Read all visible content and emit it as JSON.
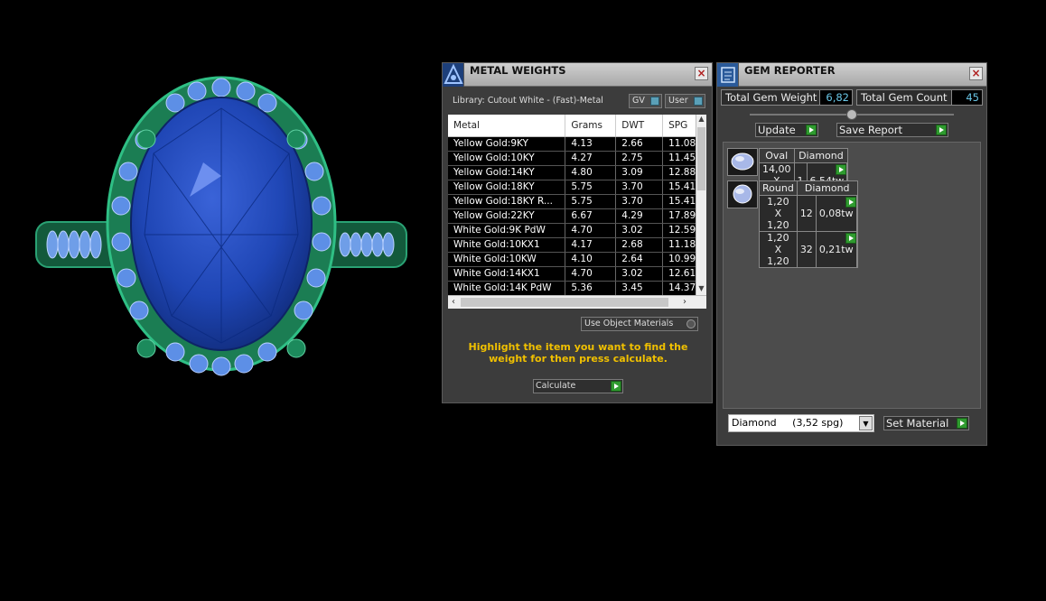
{
  "metal_weights": {
    "title": "METAL WEIGHTS",
    "library": "Library: Cutout White - (Fast)-Metal",
    "gv_label": "GV",
    "user_label": "User",
    "columns": [
      "Metal",
      "Grams",
      "DWT",
      "SPG"
    ],
    "rows": [
      [
        "Yellow Gold:9KY",
        "4.13",
        "2.66",
        "11.08"
      ],
      [
        "Yellow Gold:10KY",
        "4.27",
        "2.75",
        "11.45"
      ],
      [
        "Yellow Gold:14KY",
        "4.80",
        "3.09",
        "12.88"
      ],
      [
        "Yellow Gold:18KY",
        "5.75",
        "3.70",
        "15.41"
      ],
      [
        "Yellow Gold:18KY R...",
        "5.75",
        "3.70",
        "15.41"
      ],
      [
        "Yellow Gold:22KY",
        "6.67",
        "4.29",
        "17.89"
      ],
      [
        "White Gold:9K PdW",
        "4.70",
        "3.02",
        "12.59"
      ],
      [
        "White Gold:10KX1",
        "4.17",
        "2.68",
        "11.18"
      ],
      [
        "White Gold:10KW",
        "4.10",
        "2.64",
        "10.99"
      ],
      [
        "White Gold:14KX1",
        "4.70",
        "3.02",
        "12.61"
      ],
      [
        "White Gold:14K PdW",
        "5.36",
        "3.45",
        "14.37"
      ]
    ],
    "use_object_materials": "Use Object Materials",
    "hint": "Highlight the item you want to find the weight for then press calculate.",
    "calculate_label": "Calculate"
  },
  "gem_reporter": {
    "title": "GEM REPORTER",
    "total_weight_label": "Total Gem Weight",
    "total_weight_value": "6,82",
    "total_count_label": "Total Gem Count",
    "total_count_value": "45",
    "update_label": "Update",
    "save_report_label": "Save Report",
    "groups": [
      {
        "shape": "Oval",
        "material": "Diamond",
        "rows": [
          [
            "14,00 X 10,10",
            "1",
            "6,54tw"
          ]
        ]
      },
      {
        "shape": "Round",
        "material": "Diamond",
        "rows": [
          [
            "1,20 X 1,20",
            "12",
            "0,08tw"
          ],
          [
            "1,20 X 1,20",
            "32",
            "0,21tw"
          ]
        ]
      }
    ],
    "material_select": "Diamond     (3,52 spg)",
    "set_material_label": "Set Material"
  },
  "colors": {
    "background": "#000000",
    "panel": "#3c3c3c",
    "accent_cyan": "#69c6e6",
    "hint_yellow": "#f0c000",
    "go_green": "#2f9b2f",
    "gem_blue": "#1f46b5",
    "metal_green": "#1f8a5a"
  }
}
